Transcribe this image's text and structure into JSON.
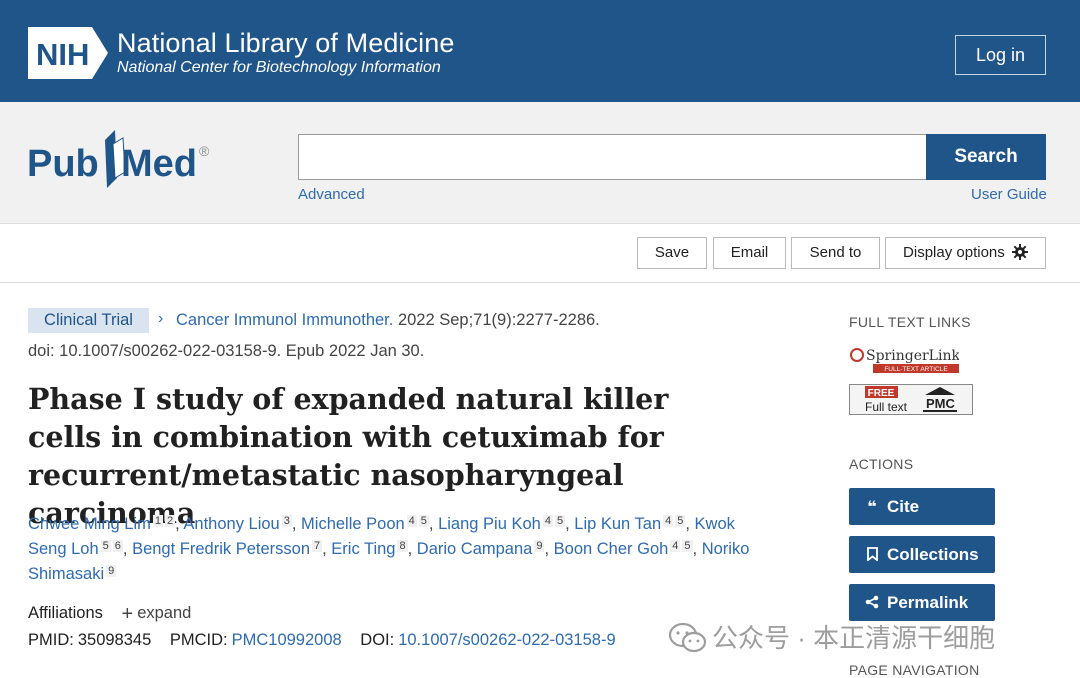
{
  "header": {
    "org_logo": "NIH",
    "org_title": "National Library of Medicine",
    "org_subtitle": "National Center for Biotechnology Information",
    "login_label": "Log in"
  },
  "search": {
    "logo_text": "PubMed",
    "value": "",
    "button_label": "Search",
    "advanced_label": "Advanced",
    "guide_label": "User Guide"
  },
  "toolbar": {
    "save_label": "Save",
    "email_label": "Email",
    "send_to_label": "Send to",
    "display_options_label": "Display options"
  },
  "article": {
    "type_badge": "Clinical Trial",
    "journal": "Cancer Immunol Immunother.",
    "citation": "2022 Sep;71(9):2277-2286.",
    "doi_line": "doi: 10.1007/s00262-022-03158-9. Epub 2022 Jan 30.",
    "title": "Phase I study of expanded natural killer cells in combination with cetuximab for recurrent/metastatic nasopharyngeal carcinoma",
    "authors": [
      {
        "name": "Chwee Ming Lim",
        "affs": [
          "1",
          "2"
        ]
      },
      {
        "name": "Anthony Liou",
        "affs": [
          "3"
        ]
      },
      {
        "name": "Michelle Poon",
        "affs": [
          "4",
          "5"
        ]
      },
      {
        "name": "Liang Piu Koh",
        "affs": [
          "4",
          "5"
        ]
      },
      {
        "name": "Lip Kun Tan",
        "affs": [
          "4",
          "5"
        ]
      },
      {
        "name": "Kwok Seng Loh",
        "affs": [
          "5",
          "6"
        ]
      },
      {
        "name": "Bengt Fredrik Petersson",
        "affs": [
          "7"
        ]
      },
      {
        "name": "Eric Ting",
        "affs": [
          "8"
        ]
      },
      {
        "name": "Dario Campana",
        "affs": [
          "9"
        ]
      },
      {
        "name": "Boon Cher Goh",
        "affs": [
          "4",
          "5"
        ]
      },
      {
        "name": "Noriko Shimasaki",
        "affs": [
          "9"
        ]
      }
    ],
    "affiliations_label": "Affiliations",
    "expand_label": "expand",
    "pmid_label": "PMID:",
    "pmid": "35098345",
    "pmcid_label": "PMCID:",
    "pmcid": "PMC10992008",
    "doi_label": "DOI:",
    "doi": "10.1007/s00262-022-03158-9"
  },
  "sidebar": {
    "full_text_heading": "FULL TEXT LINKS",
    "springer_text": "SpringerLink",
    "springer_sub": "FULL-TEXT ARTICLE",
    "pmc_free": "FREE",
    "pmc_full": "Full text",
    "pmc_label": "PMC",
    "actions_heading": "ACTIONS",
    "cite_label": "Cite",
    "collections_label": "Collections",
    "permalink_label": "Permalink",
    "page_nav_heading": "PAGE NAVIGATION"
  },
  "watermark": {
    "text": "公众号 · 本正清源干细胞"
  }
}
